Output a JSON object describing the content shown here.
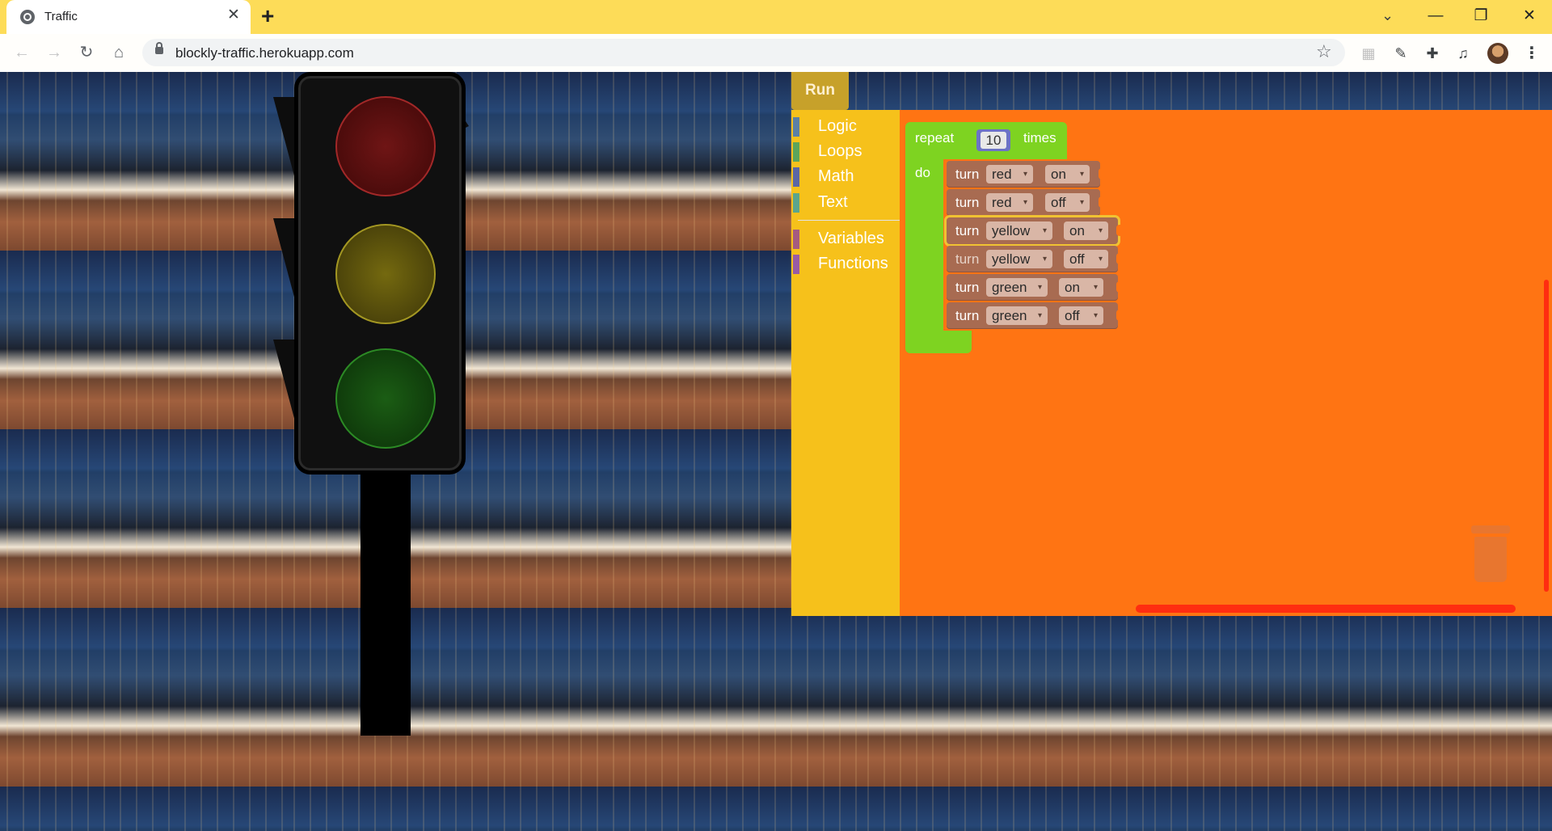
{
  "browser": {
    "tab_title": "Traffic",
    "tab_close": "✕",
    "new_tab": "+",
    "url": "blockly-traffic.herokuapp.com",
    "window_controls": {
      "minimize": "—",
      "restore": "❐",
      "close": "✕"
    },
    "icons": [
      "back-icon",
      "forward-icon",
      "reload-icon",
      "home-icon",
      "lock-icon",
      "star-icon",
      "extension-icon",
      "puzzle-icon",
      "media-icon",
      "avatar",
      "kebab-menu-icon"
    ]
  },
  "app": {
    "run_label": "Run",
    "toolbox": [
      {
        "label": "Logic",
        "color": "#5b80a5"
      },
      {
        "label": "Loops",
        "color": "#5ba55b"
      },
      {
        "label": "Math",
        "color": "#5b67a5"
      },
      {
        "label": "Text",
        "color": "#5ba58c"
      },
      {
        "label": "Variables",
        "color": "#a55b80"
      },
      {
        "label": "Functions",
        "color": "#995ba5"
      }
    ],
    "repeat_block": {
      "repeat_label": "repeat",
      "count": "10",
      "times_label": "times",
      "do_label": "do"
    },
    "turn_word": "turn",
    "turn_blocks": [
      {
        "light": "red",
        "state": "on"
      },
      {
        "light": "red",
        "state": "off"
      },
      {
        "light": "yellow",
        "state": "on"
      },
      {
        "light": "yellow",
        "state": "off"
      },
      {
        "light": "green",
        "state": "on"
      },
      {
        "light": "green",
        "state": "off"
      }
    ],
    "dropdown_arrow": "▾"
  },
  "colors": {
    "titlebar": "#fddc58",
    "toolbox": "#f6c11b",
    "workspace": "#ff7413",
    "loop_block": "#7ed321",
    "turn_block": "#a86b51"
  }
}
